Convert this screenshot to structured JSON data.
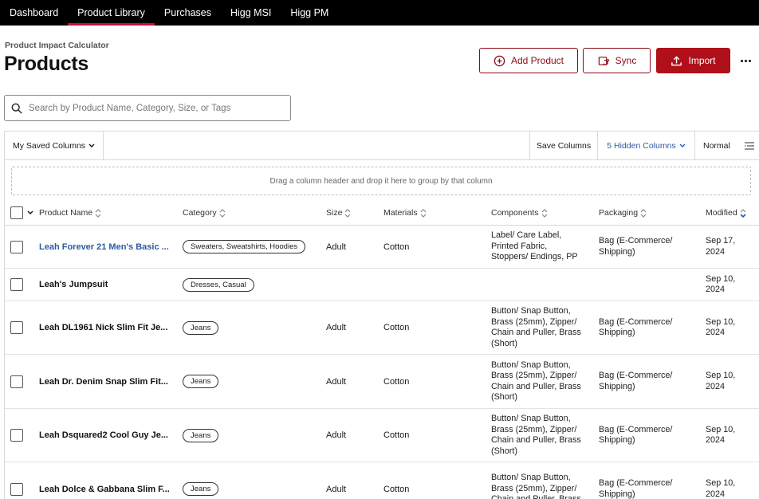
{
  "nav": {
    "items": [
      {
        "label": "Dashboard",
        "active": false
      },
      {
        "label": "Product Library",
        "active": true
      },
      {
        "label": "Purchases",
        "active": false
      },
      {
        "label": "Higg MSI",
        "active": false
      },
      {
        "label": "Higg PM",
        "active": false
      }
    ]
  },
  "header": {
    "eyebrow": "Product Impact Calculator",
    "title": "Products",
    "add_label": "Add Product",
    "sync_label": "Sync",
    "import_label": "Import"
  },
  "search": {
    "placeholder": "Search by Product Name, Category, Size, or Tags",
    "value": ""
  },
  "toolbar": {
    "saved_columns": "My Saved Columns",
    "save_columns": "Save Columns",
    "hidden_columns": "5 Hidden Columns",
    "density": "Normal"
  },
  "group_zone": "Drag a column header and drop it here to group by that column",
  "columns": [
    "Product Name",
    "Category",
    "Size",
    "Materials",
    "Components",
    "Packaging",
    "Modified"
  ],
  "rows": [
    {
      "name": "Leah Forever 21 Men's Basic ...",
      "link": true,
      "categories": [
        "Sweaters, Sweatshirts, Hoodies"
      ],
      "size": "Adult",
      "materials": "Cotton",
      "components": [
        "Label/ Care Label,",
        "Printed Fabric,",
        "Stoppers/ Endings, PP"
      ],
      "packaging": [
        "Bag (E-Commerce/",
        "Shipping)"
      ],
      "modified": [
        "Sep 17,",
        "2024"
      ]
    },
    {
      "name": "Leah's Jumpsuit",
      "link": false,
      "categories": [
        "Dresses, Casual"
      ],
      "size": "",
      "materials": "",
      "components": [],
      "packaging": [],
      "modified": [
        "Sep 10,",
        "2024"
      ]
    },
    {
      "name": "Leah DL1961 Nick Slim Fit Je...",
      "link": false,
      "categories": [
        "Jeans"
      ],
      "size": "Adult",
      "materials": "Cotton",
      "components": [
        "Button/ Snap Button,",
        "Brass (25mm), Zipper/",
        "Chain and Puller, Brass",
        "(Short)"
      ],
      "packaging": [
        "Bag (E-Commerce/",
        "Shipping)"
      ],
      "modified": [
        "Sep 10,",
        "2024"
      ]
    },
    {
      "name": "Leah Dr. Denim Snap Slim Fit...",
      "link": false,
      "categories": [
        "Jeans"
      ],
      "size": "Adult",
      "materials": "Cotton",
      "components": [
        "Button/ Snap Button,",
        "Brass (25mm), Zipper/",
        "Chain and Puller, Brass",
        "(Short)"
      ],
      "packaging": [
        "Bag (E-Commerce/",
        "Shipping)"
      ],
      "modified": [
        "Sep 10,",
        "2024"
      ]
    },
    {
      "name": "Leah Dsquared2 Cool Guy Je...",
      "link": false,
      "categories": [
        "Jeans"
      ],
      "size": "Adult",
      "materials": "Cotton",
      "components": [
        "Button/ Snap Button,",
        "Brass (25mm), Zipper/",
        "Chain and Puller, Brass",
        "(Short)"
      ],
      "packaging": [
        "Bag (E-Commerce/",
        "Shipping)"
      ],
      "modified": [
        "Sep 10,",
        "2024"
      ]
    },
    {
      "name": "Leah Dolce & Gabbana Slim F...",
      "link": false,
      "categories": [
        "Jeans"
      ],
      "size": "Adult",
      "materials": "Cotton",
      "components": [
        "Button/ Snap Button,",
        "Brass (25mm), Zipper/",
        "Chain and Puller, Brass"
      ],
      "packaging": [
        "Bag (E-Commerce/",
        "Shipping)"
      ],
      "modified": [
        "Sep 10,",
        "2024"
      ]
    }
  ]
}
